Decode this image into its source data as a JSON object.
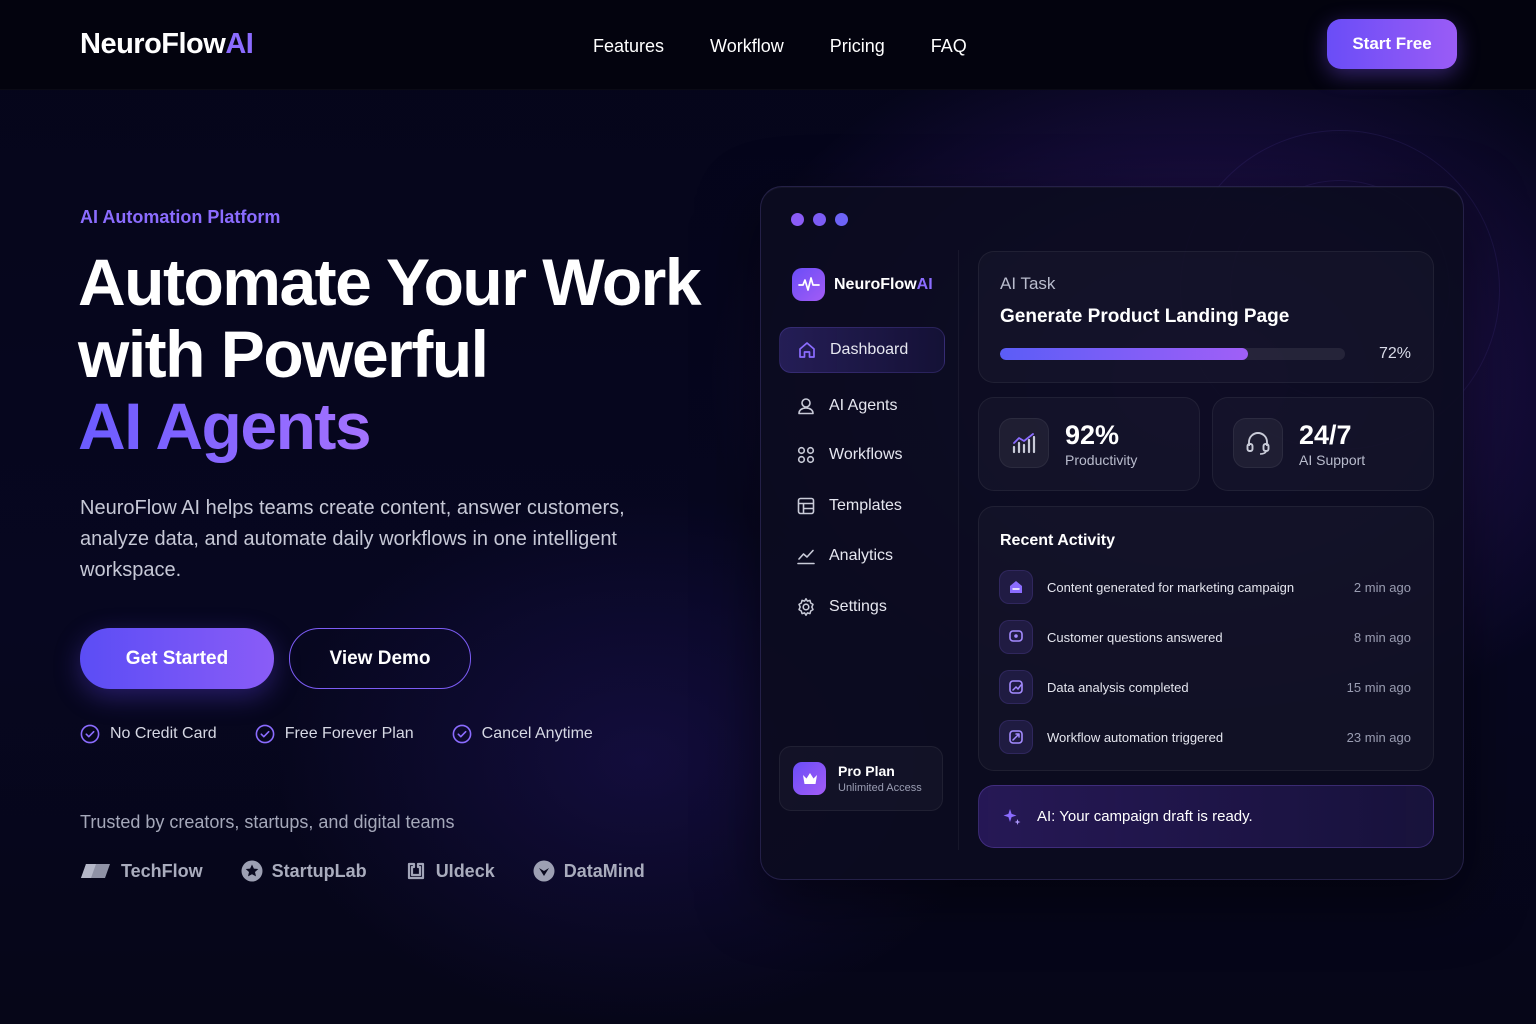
{
  "nav": {
    "logo_main": "NeuroFlow",
    "logo_accent": "AI",
    "links": [
      "Features",
      "Workflow",
      "Pricing",
      "FAQ"
    ],
    "cta": "Start Free"
  },
  "hero": {
    "eyebrow": "AI Automation Platform",
    "headline_line1": "Automate Your Work",
    "headline_line2": "with Powerful",
    "headline_line3": "AI Agents",
    "description": "NeuroFlow AI helps teams create content, answer customers, analyze data, and automate daily workflows in one intelligent workspace.",
    "primary_button": "Get Started",
    "secondary_button": "View Demo",
    "perks": [
      "No Credit Card",
      "Free Forever Plan",
      "Cancel Anytime"
    ],
    "trusted_text": "Trusted by creators, startups, and digital teams",
    "brands": [
      "TechFlow",
      "StartupLab",
      "UIdeck",
      "DataMind"
    ]
  },
  "dashboard": {
    "window_dots": [
      "#8b5cf6",
      "#7c5cf4",
      "#6d63f6"
    ],
    "app_name_main": "NeuroFlow",
    "app_name_accent": "AI",
    "sidebar": [
      {
        "label": "Dashboard",
        "icon": "home-icon",
        "active": true
      },
      {
        "label": "AI Agents",
        "icon": "agent-icon",
        "active": false
      },
      {
        "label": "Workflows",
        "icon": "grid-icon",
        "active": false
      },
      {
        "label": "Templates",
        "icon": "template-icon",
        "active": false
      },
      {
        "label": "Analytics",
        "icon": "chart-line-icon",
        "active": false
      },
      {
        "label": "Settings",
        "icon": "gear-icon",
        "active": false
      }
    ],
    "plan": {
      "title": "Pro Plan",
      "subtitle": "Unlimited Access"
    },
    "task": {
      "label": "AI Task",
      "title": "Generate Product Landing Page",
      "progress": 72,
      "progress_text": "72%"
    },
    "stats": [
      {
        "value": "92%",
        "label": "Productivity",
        "icon": "bar-chart-icon"
      },
      {
        "value": "24/7",
        "label": "AI Support",
        "icon": "headset-icon"
      }
    ],
    "activity": {
      "title": "Recent Activity",
      "items": [
        {
          "text": "Content generated for marketing campaign",
          "time": "2 min ago"
        },
        {
          "text": "Customer questions answered",
          "time": "8 min ago"
        },
        {
          "text": "Data analysis completed",
          "time": "15 min ago"
        },
        {
          "text": "Workflow automation triggered",
          "time": "23 min ago"
        }
      ]
    },
    "ai_notice": "AI: Your campaign draft is ready."
  },
  "colors": {
    "accent": "#8b6cff",
    "accent_deep": "#5b4df5",
    "background": "#05051a"
  }
}
